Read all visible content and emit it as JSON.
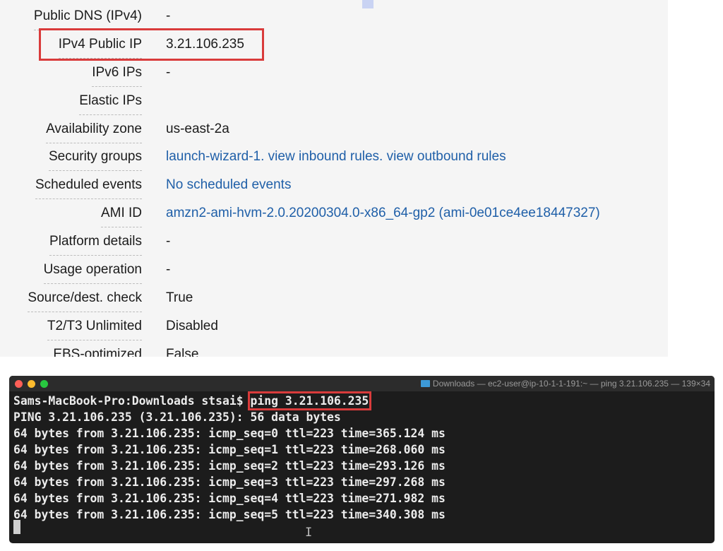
{
  "details": {
    "rows": [
      {
        "label": "Public DNS (IPv4)",
        "value": "-"
      },
      {
        "label": "IPv4 Public IP",
        "value": "3.21.106.235"
      },
      {
        "label": "IPv6 IPs",
        "value": "-"
      },
      {
        "label": "Elastic IPs",
        "value": ""
      },
      {
        "label": "Availability zone",
        "value": "us-east-2a"
      },
      {
        "label": "Security groups",
        "value": "launch-wizard-1. view inbound rules. view outbound rules"
      },
      {
        "label": "Scheduled events",
        "value": "No scheduled events"
      },
      {
        "label": "AMI ID",
        "value": "amzn2-ami-hvm-2.0.20200304.0-x86_64-gp2 (ami-0e01ce4ee18447327)"
      },
      {
        "label": "Platform details",
        "value": "-"
      },
      {
        "label": "Usage operation",
        "value": "-"
      },
      {
        "label": "Source/dest. check",
        "value": "True"
      },
      {
        "label": "T2/T3 Unlimited",
        "value": "Disabled"
      },
      {
        "label": "EBS-optimized",
        "value": "False"
      }
    ]
  },
  "terminal": {
    "title": "Downloads — ec2-user@ip-10-1-1-191:~ — ping 3.21.106.235 — 139×34",
    "prompt": "Sams-MacBook-Pro:Downloads stsai$ ",
    "command": "ping 3.21.106.235",
    "lines": [
      "PING 3.21.106.235 (3.21.106.235): 56 data bytes",
      "64 bytes from 3.21.106.235: icmp_seq=0 ttl=223 time=365.124 ms",
      "64 bytes from 3.21.106.235: icmp_seq=1 ttl=223 time=268.060 ms",
      "64 bytes from 3.21.106.235: icmp_seq=2 ttl=223 time=293.126 ms",
      "64 bytes from 3.21.106.235: icmp_seq=3 ttl=223 time=297.268 ms",
      "64 bytes from 3.21.106.235: icmp_seq=4 ttl=223 time=271.982 ms",
      "64 bytes from 3.21.106.235: icmp_seq=5 ttl=223 time=340.308 ms"
    ],
    "icons": {
      "window_controls": [
        "close",
        "minimize",
        "zoom"
      ],
      "title_icon": "folder-icon",
      "pointer": "text-cursor-icon"
    },
    "colors": {
      "highlight": "#d93b3b",
      "link": "#1f5fa8"
    }
  }
}
